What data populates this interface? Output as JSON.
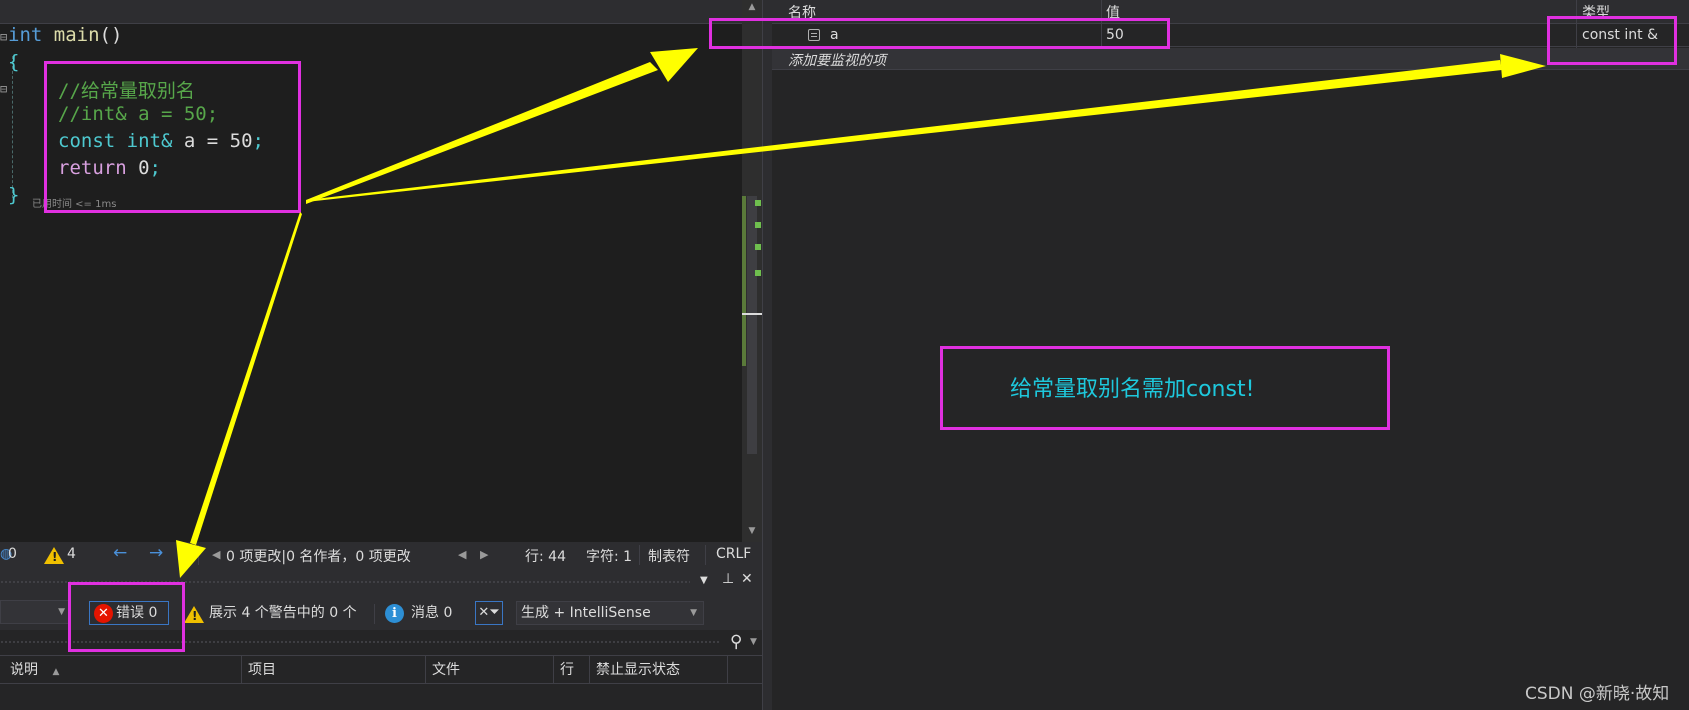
{
  "editor": {
    "lines": {
      "main_kw": "int",
      "main_fn": "main",
      "main_paren": "()",
      "open_brace": "{",
      "comment1": "//给常量取别名",
      "comment2": "//int& a = 50;",
      "const_kw": "const",
      "int_ref": "int&",
      "decl_rest": "a = 50",
      "semicolon": ";",
      "return_kw": "return",
      "return_val": "0",
      "close_brace": "}"
    },
    "elapsed": "已用时间 <= 1ms"
  },
  "statusbar": {
    "errors": "0",
    "warnings": "4",
    "changes": "0 项更改|0 名作者，0 项更改",
    "line": "行: 44",
    "char": "字符: 1",
    "tabs": "制表符",
    "eol": "CRLF"
  },
  "error_list": {
    "errors_btn": "错误 0",
    "warnings_btn": "展示 4 个警告中的 0 个",
    "messages_btn": "消息 0",
    "build_filter": "生成 + IntelliSense",
    "columns": [
      "说明",
      "项目",
      "文件",
      "行",
      "禁止显示状态"
    ],
    "sort_arrow": "▲"
  },
  "watch": {
    "headers": {
      "name": "名称",
      "value": "值",
      "type": "类型"
    },
    "row": {
      "name": "a",
      "value": "50",
      "type": "const int &"
    },
    "add_placeholder": "添加要监视的项"
  },
  "annotation": {
    "note": "给常量取别名需加const!",
    "highlight_color": "#e030e0",
    "arrow_color": "#ffff00"
  },
  "watermark": "CSDN @新晓·故知"
}
